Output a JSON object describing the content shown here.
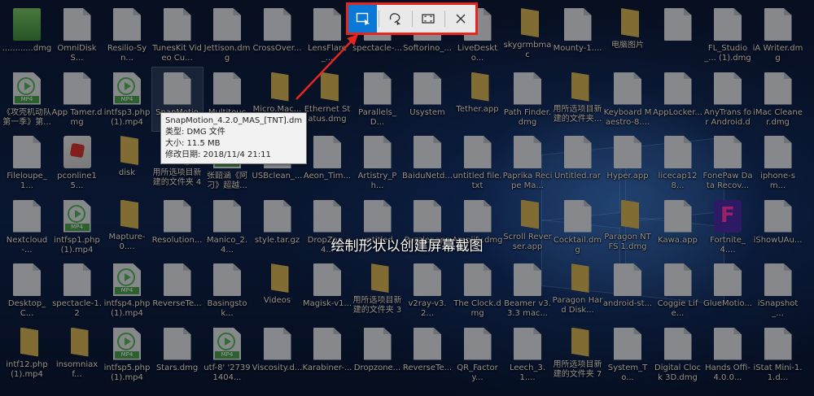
{
  "toolbar": {
    "buttons": [
      {
        "name": "rectangular-snip-button",
        "icon": "rectangle-snip-icon",
        "active": true
      },
      {
        "name": "freeform-snip-button",
        "icon": "freeform-snip-icon",
        "active": false
      },
      {
        "name": "fullscreen-snip-button",
        "icon": "fullscreen-snip-icon",
        "active": false
      },
      {
        "name": "close-snip-button",
        "icon": "close-icon",
        "active": false
      }
    ]
  },
  "hint": "绘制形状以创建屏幕截图",
  "tooltip": {
    "name": "SnapMotion_4.2.0_MAS_[TNT].dmg",
    "type": "类型: DMG 文件",
    "size": "大小: 11.5 MB",
    "date": "修改日期: 2018/11/4 21:11"
  },
  "colors": {
    "highlight": "#e5261f",
    "active_button": "#0a78d7"
  },
  "icons": [
    {
      "col": 0,
      "row": 0,
      "kind": "green",
      "label": "............dmg"
    },
    {
      "col": 1,
      "row": 0,
      "kind": "file",
      "label": "OmniDiskS..."
    },
    {
      "col": 2,
      "row": 0,
      "kind": "file",
      "label": "Resilio-Syn..."
    },
    {
      "col": 3,
      "row": 0,
      "kind": "file",
      "label": "TunesKit Video Cu..."
    },
    {
      "col": 4,
      "row": 0,
      "kind": "file",
      "label": "Jettison.dmg"
    },
    {
      "col": 5,
      "row": 0,
      "kind": "file",
      "label": "CrossOver..."
    },
    {
      "col": 6,
      "row": 0,
      "kind": "file",
      "label": "LensFlare_..."
    },
    {
      "col": 7,
      "row": 0,
      "kind": "file",
      "label": "spectacle-..."
    },
    {
      "col": 8,
      "row": 0,
      "kind": "file",
      "label": "Softorino_..."
    },
    {
      "col": 9,
      "row": 0,
      "kind": "file",
      "label": "LiveDeskto..."
    },
    {
      "col": 10,
      "row": 0,
      "kind": "folder",
      "label": "skygrmbmac"
    },
    {
      "col": 11,
      "row": 0,
      "kind": "file",
      "label": "Mounty-1...."
    },
    {
      "col": 12,
      "row": 0,
      "kind": "folder",
      "label": "电脑图片"
    },
    {
      "col": 13,
      "row": 0,
      "kind": "file",
      "label": ""
    },
    {
      "col": 14,
      "row": 0,
      "kind": "file",
      "label": "FL_Studio_... (1).dmg"
    },
    {
      "col": 15,
      "row": 0,
      "kind": "file",
      "label": "iA Writer.dmg"
    },
    {
      "col": 0,
      "row": 1,
      "kind": "video",
      "label": "《攻壳机动队第一季》第..."
    },
    {
      "col": 1,
      "row": 1,
      "kind": "file",
      "label": "App Tamer.dmg"
    },
    {
      "col": 2,
      "row": 1,
      "kind": "video",
      "label": "intfsp3.php (1).mp4"
    },
    {
      "col": 3,
      "row": 1,
      "kind": "file",
      "label": "SnapMotion...",
      "selected": true
    },
    {
      "col": 4,
      "row": 1,
      "kind": "file",
      "label": "Multitouch..."
    },
    {
      "col": 5,
      "row": 1,
      "kind": "folder",
      "label": "Micro.Mac..."
    },
    {
      "col": 6,
      "row": 1,
      "kind": "folder",
      "label": "Ethernet Status.dmg"
    },
    {
      "col": 7,
      "row": 1,
      "kind": "file",
      "label": "Parallels_D..."
    },
    {
      "col": 8,
      "row": 1,
      "kind": "file",
      "label": "Usystem"
    },
    {
      "col": 9,
      "row": 1,
      "kind": "folder",
      "label": "Tether.app"
    },
    {
      "col": 10,
      "row": 1,
      "kind": "file",
      "label": "Path Finder.dmg"
    },
    {
      "col": 11,
      "row": 1,
      "kind": "folder",
      "label": "用所选项目新建的文件夹..."
    },
    {
      "col": 12,
      "row": 1,
      "kind": "file",
      "label": "Keyboard Maestro-8...."
    },
    {
      "col": 13,
      "row": 1,
      "kind": "file",
      "label": "AppLocker..."
    },
    {
      "col": 14,
      "row": 1,
      "kind": "file",
      "label": "AnyTrans for Android.dmg"
    },
    {
      "col": 15,
      "row": 1,
      "kind": "file",
      "label": "iMac Cleaner.dmg"
    },
    {
      "col": 0,
      "row": 2,
      "kind": "file",
      "label": "Fileloupe_1..."
    },
    {
      "col": 1,
      "row": 2,
      "kind": "app",
      "label": "pconline15..."
    },
    {
      "col": 2,
      "row": 2,
      "kind": "folder",
      "label": "disk"
    },
    {
      "col": 3,
      "row": 2,
      "kind": "folder",
      "label": "用所选项目新建的文件夹 4"
    },
    {
      "col": 4,
      "row": 2,
      "kind": "video",
      "label": "张韶涵《阿刁》超越..."
    },
    {
      "col": 5,
      "row": 2,
      "kind": "file",
      "label": "USBclean_..."
    },
    {
      "col": 6,
      "row": 2,
      "kind": "file",
      "label": "Aeon_Tim..."
    },
    {
      "col": 7,
      "row": 2,
      "kind": "file",
      "label": "Artistry_Ph..."
    },
    {
      "col": 8,
      "row": 2,
      "kind": "file",
      "label": "BaiduNetd..."
    },
    {
      "col": 9,
      "row": 2,
      "kind": "file",
      "label": "untitled file.txt"
    },
    {
      "col": 10,
      "row": 2,
      "kind": "file",
      "label": "Paprika Recipe Ma..."
    },
    {
      "col": 11,
      "row": 2,
      "kind": "file",
      "label": "Untitled.rar"
    },
    {
      "col": 12,
      "row": 2,
      "kind": "file",
      "label": "Hyper.app"
    },
    {
      "col": 13,
      "row": 2,
      "kind": "file",
      "label": "licecap128..."
    },
    {
      "col": 14,
      "row": 2,
      "kind": "file",
      "label": "FonePaw Data Recov..."
    },
    {
      "col": 15,
      "row": 2,
      "kind": "file",
      "label": "iphone-sm..."
    },
    {
      "col": 0,
      "row": 3,
      "kind": "file",
      "label": "Nextcloud-..."
    },
    {
      "col": 1,
      "row": 3,
      "kind": "video",
      "label": "intfsp1.php (1).mp4"
    },
    {
      "col": 2,
      "row": 3,
      "kind": "folder",
      "label": "Mapture-0...."
    },
    {
      "col": 3,
      "row": 3,
      "kind": "file",
      "label": "Resolution..."
    },
    {
      "col": 4,
      "row": 3,
      "kind": "file",
      "label": "Manico_2.4..."
    },
    {
      "col": 5,
      "row": 3,
      "kind": "file",
      "label": "style.tar.gz"
    },
    {
      "col": 6,
      "row": 3,
      "kind": "file",
      "label": "DropZap_4..."
    },
    {
      "col": 7,
      "row": 3,
      "kind": "file",
      "label": "untitled"
    },
    {
      "col": 8,
      "row": 3,
      "kind": "file",
      "label": "Puzzler.app"
    },
    {
      "col": 9,
      "row": 3,
      "kind": "file",
      "label": "Amplify.dmg"
    },
    {
      "col": 10,
      "row": 3,
      "kind": "folder",
      "label": "Scroll Reverser.app"
    },
    {
      "col": 11,
      "row": 3,
      "kind": "file",
      "label": "Cocktail.dmg"
    },
    {
      "col": 12,
      "row": 3,
      "kind": "folder",
      "label": "Paragon NTFS 1.dmg"
    },
    {
      "col": 13,
      "row": 3,
      "kind": "file",
      "label": "Kawa.app"
    },
    {
      "col": 14,
      "row": 3,
      "kind": "logo",
      "label": "Fortnite_4...."
    },
    {
      "col": 15,
      "row": 3,
      "kind": "file",
      "label": "iShowUAu..."
    },
    {
      "col": 0,
      "row": 4,
      "kind": "file",
      "label": "Desktop_C..."
    },
    {
      "col": 1,
      "row": 4,
      "kind": "file",
      "label": "spectacle-1.2"
    },
    {
      "col": 2,
      "row": 4,
      "kind": "video",
      "label": "intfsp4.php (1).mp4"
    },
    {
      "col": 3,
      "row": 4,
      "kind": "file",
      "label": "ReverseTe..."
    },
    {
      "col": 4,
      "row": 4,
      "kind": "file",
      "label": "Basingstok..."
    },
    {
      "col": 5,
      "row": 4,
      "kind": "folder",
      "label": "Videos"
    },
    {
      "col": 6,
      "row": 4,
      "kind": "file",
      "label": "Magisk-v1..."
    },
    {
      "col": 7,
      "row": 4,
      "kind": "folder",
      "label": "用所选项目新建的文件夹 3"
    },
    {
      "col": 8,
      "row": 4,
      "kind": "file",
      "label": "v2ray-v3.2..."
    },
    {
      "col": 9,
      "row": 4,
      "kind": "file",
      "label": "The Clock.dmg"
    },
    {
      "col": 10,
      "row": 4,
      "kind": "file",
      "label": "Beamer v3.3.3 mac..."
    },
    {
      "col": 11,
      "row": 4,
      "kind": "folder",
      "label": "Paragon Hard Disk..."
    },
    {
      "col": 12,
      "row": 4,
      "kind": "file",
      "label": "android-st..."
    },
    {
      "col": 13,
      "row": 4,
      "kind": "file",
      "label": "Coggie Life..."
    },
    {
      "col": 14,
      "row": 4,
      "kind": "file",
      "label": "GlueMotio..."
    },
    {
      "col": 15,
      "row": 4,
      "kind": "file",
      "label": "iSnapshot_..."
    },
    {
      "col": 0,
      "row": 5,
      "kind": "folder",
      "label": "intf12.php (1).mp4"
    },
    {
      "col": 1,
      "row": 5,
      "kind": "folder",
      "label": "insomniaxf..."
    },
    {
      "col": 2,
      "row": 5,
      "kind": "video",
      "label": "intfsp5.php (1).mp4"
    },
    {
      "col": 3,
      "row": 5,
      "kind": "file",
      "label": "Stars.dmg"
    },
    {
      "col": 4,
      "row": 5,
      "kind": "video",
      "label": "utf-8' '27391404..."
    },
    {
      "col": 5,
      "row": 5,
      "kind": "file",
      "label": "Viscosity.d..."
    },
    {
      "col": 6,
      "row": 5,
      "kind": "file",
      "label": "Karabiner-..."
    },
    {
      "col": 7,
      "row": 5,
      "kind": "file",
      "label": "Dropzone..."
    },
    {
      "col": 8,
      "row": 5,
      "kind": "file",
      "label": "ReverseTe..."
    },
    {
      "col": 9,
      "row": 5,
      "kind": "file",
      "label": "QR_Factory..."
    },
    {
      "col": 10,
      "row": 5,
      "kind": "file",
      "label": "Leech_3.1...."
    },
    {
      "col": 11,
      "row": 5,
      "kind": "folder",
      "label": "用所选项目新建的文件夹 7"
    },
    {
      "col": 12,
      "row": 5,
      "kind": "file",
      "label": "System_To..."
    },
    {
      "col": 13,
      "row": 5,
      "kind": "file",
      "label": "Digital Clock 3D.dmg"
    },
    {
      "col": 14,
      "row": 5,
      "kind": "file",
      "label": "Hands Offi-4.0.0..."
    },
    {
      "col": 15,
      "row": 5,
      "kind": "file",
      "label": "iStat Mini-1.1.d..."
    }
  ]
}
